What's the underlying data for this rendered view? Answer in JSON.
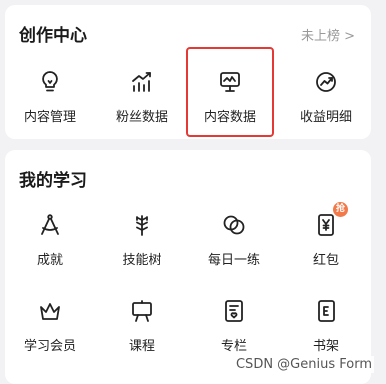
{
  "creation_center": {
    "title": "创作中心",
    "link": "未上榜 >",
    "items": [
      {
        "label": "内容管理",
        "icon": "lightbulb-icon"
      },
      {
        "label": "粉丝数据",
        "icon": "trend-bars-icon"
      },
      {
        "label": "内容数据",
        "icon": "monitor-chart-icon"
      },
      {
        "label": "收益明细",
        "icon": "income-chart-icon"
      }
    ]
  },
  "my_learning": {
    "title": "我的学习",
    "items": [
      {
        "label": "成就",
        "icon": "compass-icon"
      },
      {
        "label": "技能树",
        "icon": "wheat-icon"
      },
      {
        "label": "每日一练",
        "icon": "circles-icon"
      },
      {
        "label": "红包",
        "icon": "yen-envelope-icon",
        "badge": "抢"
      },
      {
        "label": "学习会员",
        "icon": "crown-icon"
      },
      {
        "label": "课程",
        "icon": "easel-icon"
      },
      {
        "label": "专栏",
        "icon": "doc-heart-icon"
      },
      {
        "label": "书架",
        "icon": "book-icon"
      }
    ]
  },
  "watermark": "CSDN @Genius Form"
}
